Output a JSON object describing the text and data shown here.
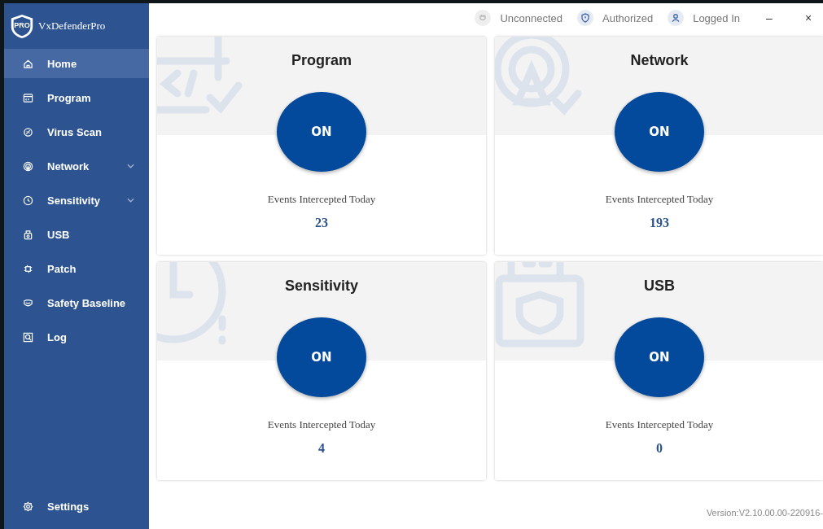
{
  "app": {
    "name": "VxDefenderPro",
    "logo_text": "PRO"
  },
  "sidebar": {
    "items": [
      {
        "label": "Home",
        "selected": true,
        "has_submenu": false
      },
      {
        "label": "Program",
        "selected": false,
        "has_submenu": false
      },
      {
        "label": "Virus Scan",
        "selected": false,
        "has_submenu": false
      },
      {
        "label": "Network",
        "selected": false,
        "has_submenu": true
      },
      {
        "label": "Sensitivity",
        "selected": false,
        "has_submenu": true
      },
      {
        "label": "USB",
        "selected": false,
        "has_submenu": false
      },
      {
        "label": "Patch",
        "selected": false,
        "has_submenu": false
      },
      {
        "label": "Safety Baseline",
        "selected": false,
        "has_submenu": false
      },
      {
        "label": "Log",
        "selected": false,
        "has_submenu": false
      }
    ],
    "footer": {
      "label": "Settings"
    }
  },
  "status_bar": [
    {
      "label": "Unconnected",
      "active": false
    },
    {
      "label": "Authorized",
      "active": true
    },
    {
      "label": "Logged In",
      "active": true
    }
  ],
  "window_controls": [
    "–",
    "×"
  ],
  "cards": [
    {
      "title": "Program",
      "state": "ON",
      "caption": "Events Intercepted Today",
      "count": "23"
    },
    {
      "title": "Network",
      "state": "ON",
      "caption": "Events Intercepted Today",
      "count": "193"
    },
    {
      "title": "Sensitivity",
      "state": "ON",
      "caption": "Events Intercepted Today",
      "count": "4"
    },
    {
      "title": "USB",
      "state": "ON",
      "caption": "Events Intercepted Today",
      "count": "0"
    }
  ],
  "version": "Version:V2.10.00.00-220916-"
}
